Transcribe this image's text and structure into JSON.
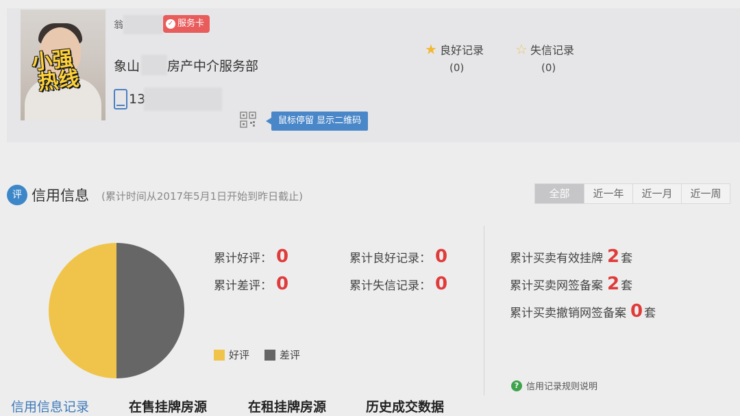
{
  "profile": {
    "name": "翁",
    "service_badge": "服务卡",
    "company": "象山",
    "company_suffix": "房产中介服务部",
    "phone_prefix": "13",
    "qr_tooltip": "鼠标停留 显示二维码",
    "avatar_logo_line1": "小强",
    "avatar_logo_line2": "热线"
  },
  "records": {
    "good_label": "良好记录",
    "good_count": "(0)",
    "bad_label": "失信记录",
    "bad_count": "(0)"
  },
  "credit": {
    "badge": "评",
    "title": "信用信息",
    "note": "(累计时间从2017年5月1日开始到昨日截止)",
    "tabs": [
      "全部",
      "近一年",
      "近一月",
      "近一周"
    ],
    "active_tab": "全部",
    "stats": {
      "good_review_label": "累计好评：",
      "good_review_value": "0",
      "bad_review_label": "累计差评：",
      "bad_review_value": "0",
      "good_record_label": "累计良好记录：",
      "good_record_value": "0",
      "bad_record_label": "累计失信记录：",
      "bad_record_value": "0"
    },
    "listings": [
      {
        "label": "累计买卖有效挂牌",
        "value": "2",
        "unit": "套"
      },
      {
        "label": "累计买卖网签备案",
        "value": "2",
        "unit": "套"
      },
      {
        "label": "累计买卖撤销网签备案",
        "value": "0",
        "unit": "套"
      }
    ],
    "rules_link": "信用记录规则说明"
  },
  "chart_data": {
    "type": "pie",
    "labels": [
      "好评",
      "差评"
    ],
    "values": [
      50,
      50
    ],
    "colors": [
      "#f0c44a",
      "#666666"
    ]
  },
  "bottom_tabs": [
    "信用信息记录",
    "在售挂牌房源",
    "在租挂牌房源",
    "历史成交数据"
  ],
  "colors": {
    "accent_blue": "#3d87c9",
    "badge_red": "#e85c5c",
    "number_red": "#e03b3b",
    "star_gold": "#f3b833"
  }
}
